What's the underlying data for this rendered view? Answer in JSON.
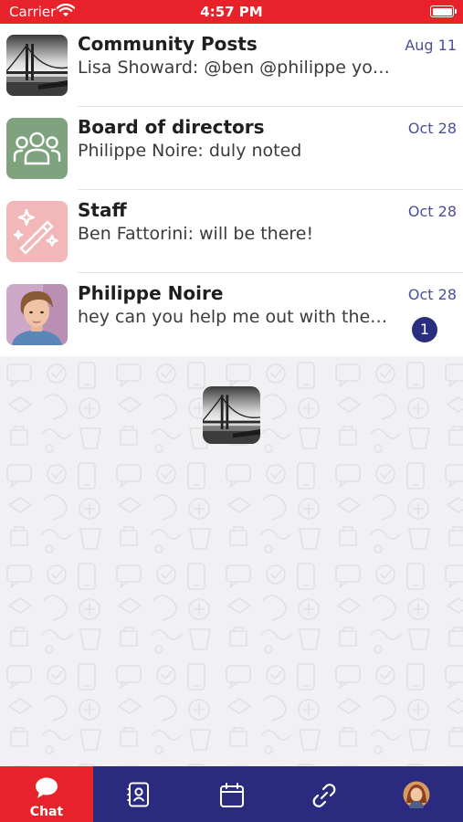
{
  "status_bar": {
    "carrier": "Carrier",
    "time": "4:57 PM",
    "battery_level": 1.0
  },
  "conversations": [
    {
      "title": "Community Posts",
      "preview": "Lisa Showard: @ben @philippe you need to check this out!",
      "date": "Aug 11",
      "avatar": "bridge-photo"
    },
    {
      "title": "Board of directors",
      "preview": "Philippe Noire: duly noted",
      "date": "Oct 28",
      "avatar": "group-icon",
      "avatar_color": "#7fa37f"
    },
    {
      "title": "Staff",
      "preview": "Ben Fattorini: will be there!",
      "date": "Oct 28",
      "avatar": "magic-wand-icon",
      "avatar_color": "#f1b7b9"
    },
    {
      "title": "Philippe Noire",
      "preview": "hey can you help me out with the schedule for tomorrow?",
      "date": "Oct 28",
      "avatar": "person-photo",
      "unread": "1"
    }
  ],
  "tab_bar": {
    "tabs": [
      {
        "label": "Chat",
        "icon": "chat-bubble-icon",
        "active": true
      },
      {
        "label": "",
        "icon": "contacts-icon"
      },
      {
        "label": "",
        "icon": "calendar-icon"
      },
      {
        "label": "",
        "icon": "link-icon"
      },
      {
        "label": "",
        "icon": "profile-avatar"
      }
    ]
  },
  "colors": {
    "accent_red": "#e8222b",
    "navy": "#2a2b7f",
    "date_text": "#4a4f9a"
  }
}
